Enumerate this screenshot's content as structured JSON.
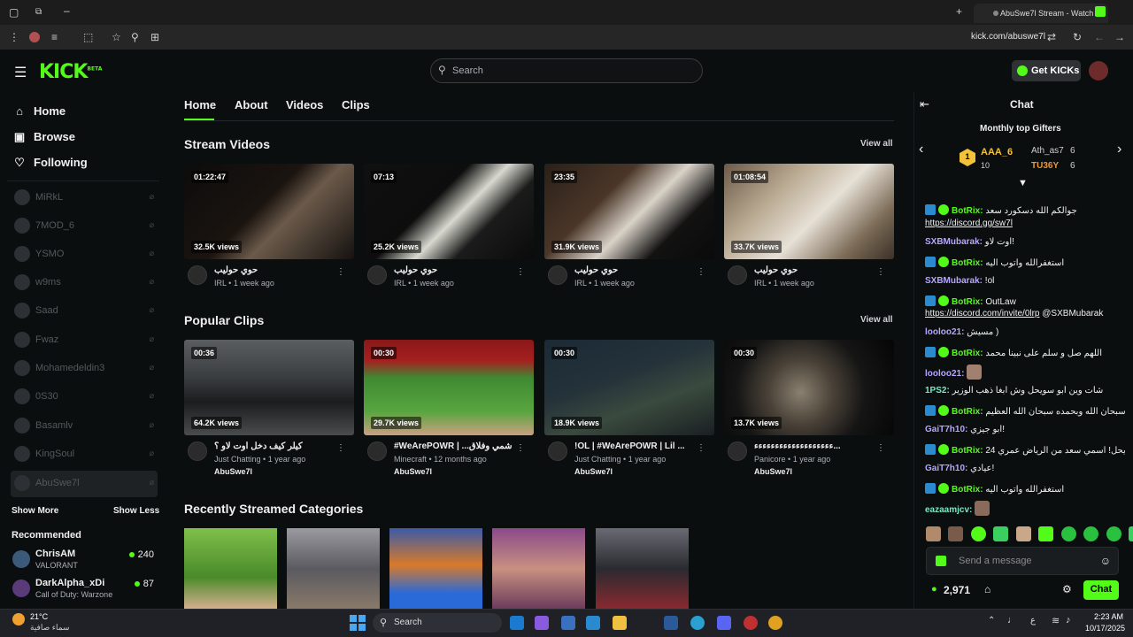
{
  "browser": {
    "tab_title": "AbuSwe7l Stream - Watch L",
    "url": "kick.com/abuswe7l"
  },
  "header": {
    "logo": "KICK",
    "logo_tag": "BETA",
    "search_placeholder": "Search",
    "get_kicks": "Get KICKs"
  },
  "sidebar": {
    "nav": [
      {
        "label": "Home",
        "icon": "home-icon"
      },
      {
        "label": "Browse",
        "icon": "browse-icon"
      },
      {
        "label": "Following",
        "icon": "heart-icon"
      }
    ],
    "channels": [
      "MiRkL",
      "7MOD_6",
      "YSMO",
      "w9ms",
      "Saad",
      "Fwaz",
      "Mohamedeldin3",
      "0S30",
      "Basamlv",
      "KingSoul",
      "AbuSwe7l"
    ],
    "show_more": "Show More",
    "show_less": "Show Less",
    "recommended_title": "Recommended",
    "recommended": [
      {
        "name": "ChrisAM",
        "category": "VALORANT",
        "viewers": "240"
      },
      {
        "name": "DarkAlpha_xDi",
        "category": "Call of Duty: Warzone",
        "viewers": "87"
      }
    ]
  },
  "main": {
    "tabs": [
      "Home",
      "About",
      "Videos",
      "Clips"
    ],
    "stream_videos_title": "Stream Videos",
    "popular_clips_title": "Popular Clips",
    "categories_title": "Recently Streamed Categories",
    "view_all": "View all",
    "videos": [
      {
        "duration": "01:22:47",
        "views": "32.5K views",
        "title": "حوي حوليب",
        "category": "IRL",
        "age": "1 week ago"
      },
      {
        "duration": "07:13",
        "views": "25.2K views",
        "title": "حوي حوليب",
        "category": "IRL",
        "age": "1 week ago"
      },
      {
        "duration": "23:35",
        "views": "31.9K views",
        "title": "حوي حوليب",
        "category": "IRL",
        "age": "1 week ago"
      },
      {
        "duration": "01:08:54",
        "views": "33.7K views",
        "title": "حوي حوليب",
        "category": "IRL",
        "age": "1 week ago"
      }
    ],
    "clips": [
      {
        "duration": "00:36",
        "views": "64.2K views",
        "title": "كيلر كيف دخل اوت لاو ؟",
        "category": "Just Chatting",
        "age": "1 year ago",
        "owner": "AbuSwe7l"
      },
      {
        "duration": "00:30",
        "views": "29.7K views",
        "title": "#WeArePOWR | ...شمي وفلاق",
        "category": "Minecraft",
        "age": "12 months ago",
        "owner": "AbuSwe7l"
      },
      {
        "duration": "00:30",
        "views": "18.9K views",
        "title": "!OL | #WeArePOWR | Lil ...",
        "category": "Just Chatting",
        "age": "1 year ago",
        "owner": "AbuSwe7l"
      },
      {
        "duration": "00:30",
        "views": "13.7K views",
        "title": "ءءءءءءءءءءءءءءءءءءء...",
        "category": "Panicore",
        "age": "1 year ago",
        "owner": "AbuSwe7l"
      }
    ]
  },
  "chat": {
    "title": "Chat",
    "gifters_title": "Monthly top Gifters",
    "gifters": [
      {
        "name": "AAA_6",
        "count": "10",
        "rank": "1"
      },
      {
        "name": "Ath_as7",
        "count": "6"
      },
      {
        "name": "TU36Y",
        "count": "6"
      }
    ],
    "messages": [
      {
        "user": "BotRix:",
        "text": "جوالكم الله دسكورد سعد",
        "link": "https://discord.gg/sw7l"
      },
      {
        "user": "SXBMubarak:",
        "text": "اوت لاو!"
      },
      {
        "user": "BotRix:",
        "text": "استغفرالله واتوب اليه"
      },
      {
        "user": "SXBMubarak:",
        "text": "!ol"
      },
      {
        "user": "BotRix:",
        "text": "OutLaw",
        "link": "https://discord.com/invite/0lrp",
        "mention": "@SXBMubarak"
      },
      {
        "user": "looloo21:",
        "text": "مسيش )"
      },
      {
        "user": "BotRix:",
        "text": "اللهم صل و سلم على نبينا محمد"
      },
      {
        "user": "looloo21:",
        "text": ""
      },
      {
        "user": "1PS2:",
        "text": "شات وين ابو سويحل وش ابغا ذهب الوزير"
      },
      {
        "user": "BotRix:",
        "text": "سبحان الله وبحمده سبحان الله العظيم"
      },
      {
        "user": "GaiT7h10:",
        "text": "ابو جيزي!"
      },
      {
        "user": "BotRix:",
        "text": "24 سويحل! اسمي سعد من الرياض عمري"
      },
      {
        "user": "GaiT7h10:",
        "text": "عيادي!"
      },
      {
        "user": "BotRix:",
        "text": "استغفرالله واتوب اليه"
      },
      {
        "user": "eazaamjcv:",
        "text": ""
      }
    ],
    "send_placeholder": "Send a message",
    "points": "2,971",
    "chat_button": "Chat"
  },
  "taskbar": {
    "temp": "21°C",
    "weather": "سماء صافية",
    "search": "Search",
    "lang": "ع",
    "time": "2:23 AM",
    "date": "10/17/2025"
  }
}
